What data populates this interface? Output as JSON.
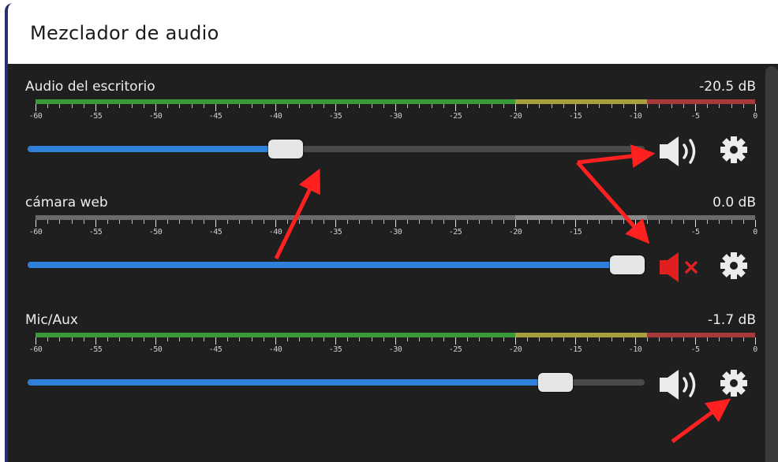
{
  "header": {
    "title": "Mezclador de audio"
  },
  "scale_labels": [
    "-60",
    "-55",
    "-50",
    "-45",
    "-40",
    "-35",
    "-30",
    "-25",
    "-20",
    "-15",
    "-10",
    "-5",
    "0"
  ],
  "channels": [
    {
      "name": "Audio del escritorio",
      "db": "-20.5 dB",
      "slider_level_pct": 43,
      "muted": false,
      "meter_active": true,
      "volume_icon": "speaker-icon",
      "settings_icon": "gear-icon"
    },
    {
      "name": "cámara web",
      "db": "0.0 dB",
      "slider_level_pct": 100,
      "muted": true,
      "meter_active": false,
      "volume_icon": "speaker-muted-icon",
      "settings_icon": "gear-icon"
    },
    {
      "name": "Mic/Aux",
      "db": "-1.7 dB",
      "slider_level_pct": 88,
      "muted": false,
      "meter_active": true,
      "volume_icon": "speaker-icon",
      "settings_icon": "gear-icon"
    }
  ],
  "colors": {
    "panel_bg": "#1f1f1f",
    "slider_fill": "#2f80d8",
    "meter_green": "#3a9a3a",
    "meter_yellow": "#a8a03a",
    "meter_red": "#a83a3a",
    "meter_inactive": "#6a6a6a",
    "muted_red": "#e02020",
    "annotation_arrow": "#ff2020"
  }
}
